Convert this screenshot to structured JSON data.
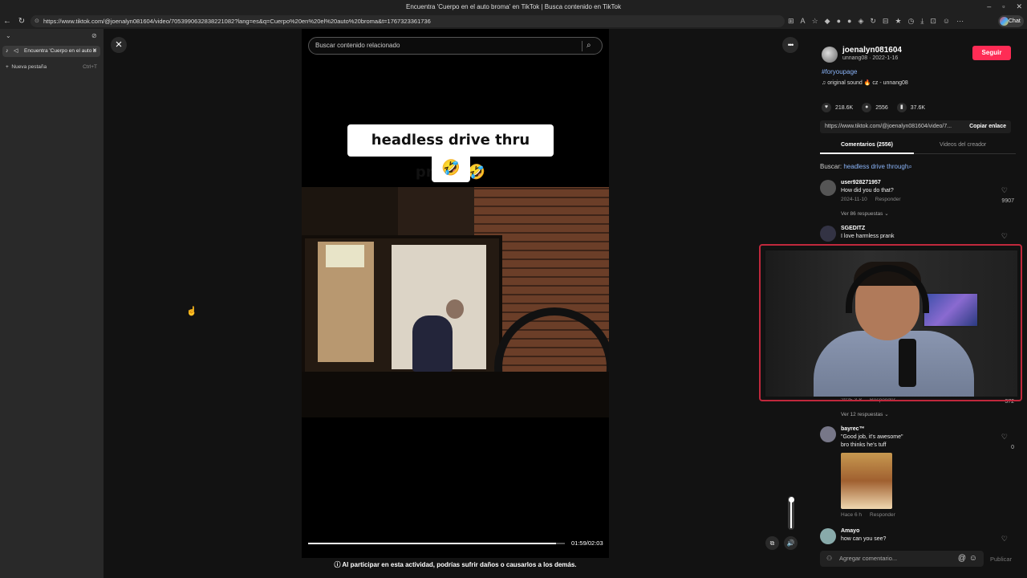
{
  "browser": {
    "window_title": "Encuentra 'Cuerpo en el auto broma' en TikTok | Busca contenido en TikTok",
    "url": "https://www.tiktok.com/@joenalyn081604/video/7053990632838221082?lang=es&q=Cuerpo%20en%20el%20auto%20broma&t=1767323361736",
    "chat_label": "Chat",
    "tab_title": "Encuentra 'Cuerpo en el auto b",
    "new_tab_label": "Nueva pestaña",
    "new_tab_shortcut": "Ctrl+T"
  },
  "video": {
    "search_placeholder": "Buscar contenido relacionado",
    "caption_line1": "headless drive thru prank 🤣",
    "caption_line2": "🤣",
    "time": "01:59/02:03",
    "progress": 0.967,
    "volume": 0.9,
    "warning": "Al participar en esta actividad, podrías sufrir daños o causarlos a los demás."
  },
  "author": {
    "username": "joenalyn081604",
    "meta": "unnang08 · 2022-1-16",
    "follow_label": "Seguir",
    "hashtag": "#foryoupage",
    "sound": "original sound 🔥 cz - unnang08",
    "likes": "218.6K",
    "comments": "2556",
    "saves": "37.6K",
    "share_link": "https://www.tiktok.com/@joenalyn081604/video/7...",
    "copy_label": "Copiar enlace"
  },
  "tabs": {
    "comments_label": "Comentarios (2556)",
    "creator_label": "Videos del creador"
  },
  "search": {
    "prefix": "Buscar:",
    "query": "headless drive through"
  },
  "comments": [
    {
      "user": "user928271957",
      "text": "How did you do that?",
      "date": "2024-11-10",
      "reply": "Responder",
      "likes": "9907",
      "more": "Ver 86 respuestas"
    },
    {
      "user": "SGEDITZ",
      "text": "I love harmless prank"
    },
    {
      "partial_meta": "2025-3-8",
      "reply": "Responder",
      "likes": "372",
      "more": "Ver 12 respuestas"
    },
    {
      "user": "bayrec™",
      "text": "\"Good job, it's awesome\"",
      "text2": "bro thinks he's tuff",
      "date": "Hace 6 h",
      "reply": "Responder",
      "likes": "0"
    },
    {
      "user": "Amayo",
      "text": "how can you see?"
    }
  ],
  "composer": {
    "placeholder": "Agregar comentario...",
    "publish_label": "Publicar"
  },
  "colors": {
    "accent": "#fe2c55",
    "link": "#8ab4f8",
    "webcam_frame": "#c0283c"
  }
}
